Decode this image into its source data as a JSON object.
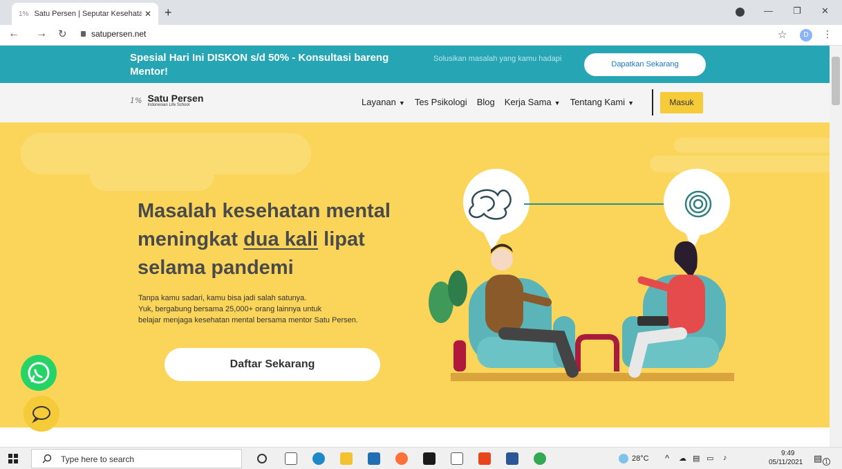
{
  "browser": {
    "tab_title": "Satu Persen | Seputar Kesehatan",
    "url": "satupersen.net",
    "profile_initial": "D"
  },
  "promo": {
    "title": "Spesial Hari Ini DISKON s/d 50% - Konsultasi bareng Mentor!",
    "subtitle": "Solusikan masalah yang kamu hadapi",
    "button": "Dapatkan Sekarang"
  },
  "header": {
    "logo_mark": "1%",
    "logo_name": "Satu Persen",
    "logo_tagline": "Indonesian Life School",
    "menu": [
      "Layanan",
      "Tes Psikologi",
      "Blog",
      "Kerja Sama",
      "Tentang Kami"
    ],
    "login": "Masuk"
  },
  "hero": {
    "title_1": "Masalah kesehatan mental",
    "title_2a": "meningkat ",
    "title_2b": "dua kali",
    "title_2c": " lipat",
    "title_3": "selama pandemi",
    "desc_1": "Tanpa kamu sadari, kamu bisa jadi salah satunya.",
    "desc_2": "Yuk, bergabung bersama 25,000+ orang lainnya untuk",
    "desc_3": "belajar menjaga kesehatan mental bersama mentor Satu Persen.",
    "cta": "Daftar Sekarang"
  },
  "taskbar": {
    "search_placeholder": "Type here to search",
    "temperature": "28°C",
    "time": "9:49",
    "date": "05/11/2021",
    "notif_count": "1"
  },
  "colors": {
    "promo_bg": "#26a6b4",
    "hero_bg": "#fbd559",
    "accent": "#f5cb3a"
  }
}
